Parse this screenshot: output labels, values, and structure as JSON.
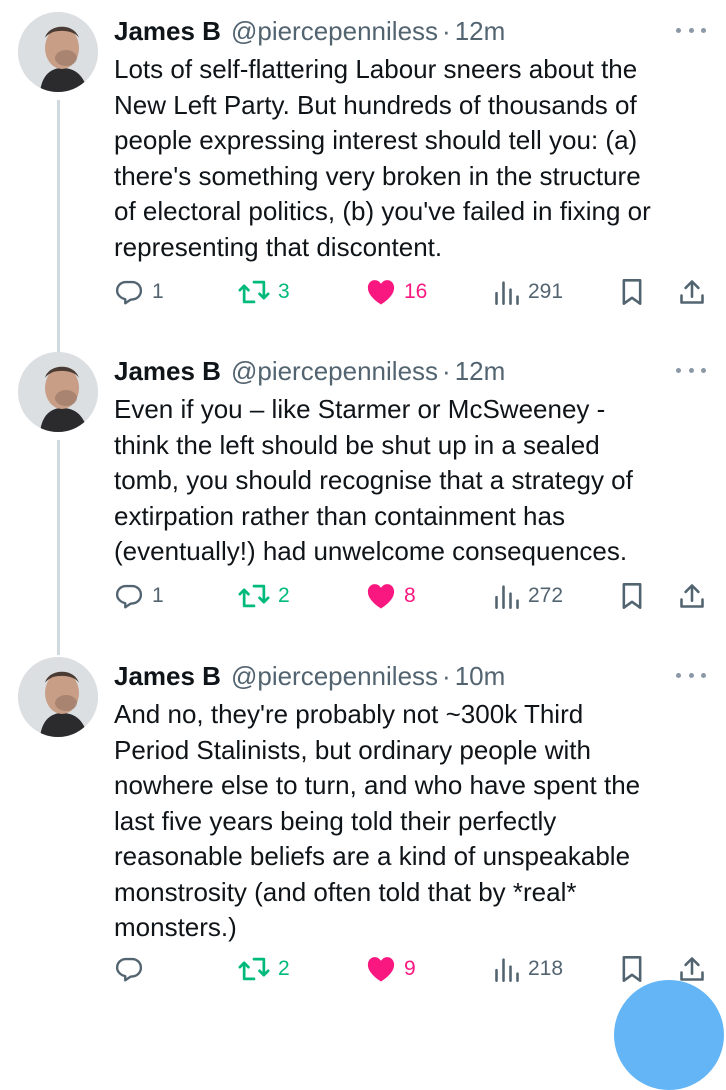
{
  "tweets": [
    {
      "name": "James B",
      "handle": "@piercepenniless",
      "dot": "·",
      "time": "12m",
      "text": "Lots of self-flattering Labour sneers about the\nNew Left Party. But hundreds of thousands of\npeople expressing interest should tell you: (a)\nthere's something very broken in the structure\nof electoral politics, (b) you've failed in fixing or\nrepresenting that discontent.",
      "replies": "1",
      "retweets": "3",
      "likes": "16",
      "views": "291"
    },
    {
      "name": "James B",
      "handle": "@piercepenniless",
      "dot": "·",
      "time": "12m",
      "text": "Even if you – like Starmer or McSweeney -\nthink the left should be shut up in a sealed\ntomb, you should recognise that a strategy of\nextirpation rather than containment has\n(eventually!) had unwelcome consequences.",
      "replies": "1",
      "retweets": "2",
      "likes": "8",
      "views": "272"
    },
    {
      "name": "James B",
      "handle": "@piercepenniless",
      "dot": "·",
      "time": "10m",
      "text": "And no, they're probably not ~300k Third\nPeriod Stalinists, but ordinary people with\nnowhere else to turn, and who have spent the\nlast five years being told their perfectly\nreasonable beliefs are a kind of unspeakable\nmonstrosity (and often told that by *real*\nmonsters.)",
      "replies": "",
      "retweets": "2",
      "likes": "9",
      "views": "218"
    }
  ],
  "colors": {
    "text": "#0f1419",
    "secondary": "#536471",
    "retweet": "#00ba7c",
    "like": "#f91880",
    "thread_line": "#cfd9de"
  },
  "icons": [
    "reply-icon",
    "retweet-icon",
    "heart-icon",
    "views-icon",
    "bookmark-icon",
    "share-icon",
    "more-icon"
  ]
}
